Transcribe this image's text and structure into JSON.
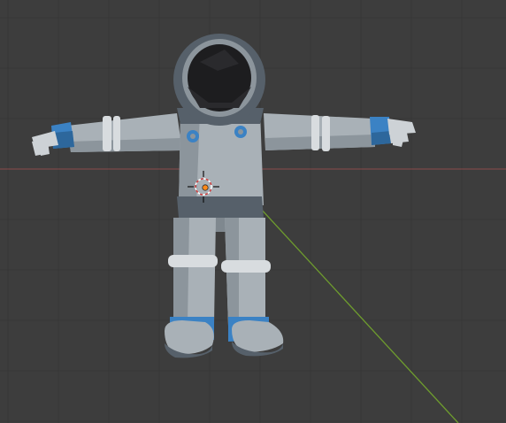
{
  "viewport": {
    "background_color": "#3d3d3d",
    "grid_color": "#373737",
    "x_axis_color": "#8a4a4a",
    "y_axis_color": "#6e9c2e"
  },
  "model": {
    "suit_color": "#a9b1b7",
    "suit_shadow_color": "#7f888f",
    "suit_dark_color": "#56606a",
    "accent_color": "#3b82c4",
    "visor_color": "#1d1d1f",
    "band_color": "#d8dcdf"
  },
  "origin_marker": {
    "icon": "3d-cursor-icon",
    "color": "#ff8a1a"
  }
}
